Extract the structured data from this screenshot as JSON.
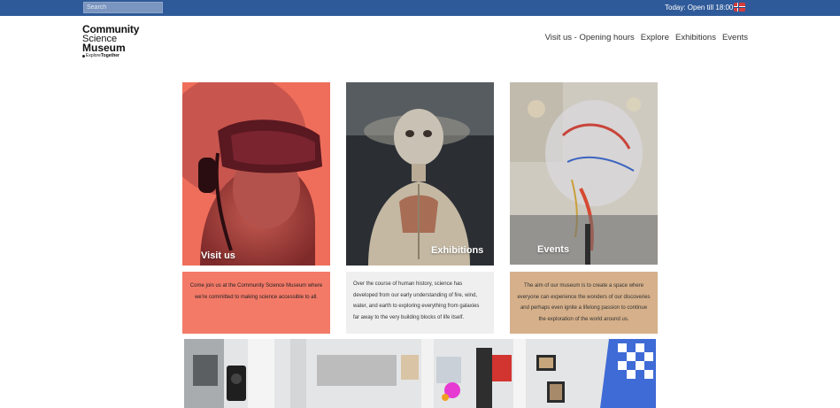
{
  "topbar": {
    "search_placeholder": "Search",
    "opening_status": "Today: Open till 18:00",
    "language_flag": "norwegian-flag-icon",
    "colors": {
      "bar": "#2f5a99"
    }
  },
  "logo": {
    "line1": "Community",
    "line2": "Science",
    "line3": "Museum",
    "tagline_regular": "Explore",
    "tagline_bold": "Together"
  },
  "nav": {
    "items": [
      "Visit us - Opening hours",
      "Explore",
      "Exhibitions",
      "Events"
    ]
  },
  "cards": [
    {
      "title": "Visit us",
      "text": "Come join us at the Community Science Museum where we're committed to making science accessible to all.",
      "color": "#f47a68"
    },
    {
      "title": "Exhibitions",
      "text": "Over the course of human history, science has developed from our early understanding of fire, wind, water, and earth to exploring everything from galaxies far away to the very building blocks of life itself.",
      "color": "#efefef"
    },
    {
      "title": "Events",
      "text": "The aim of our museum is to create a space where everyone can experience the wonders of our discoveries and perhaps even ignite a lifelong passion to continue the exploration of the world around us.",
      "color": "#d6b08a"
    }
  ]
}
